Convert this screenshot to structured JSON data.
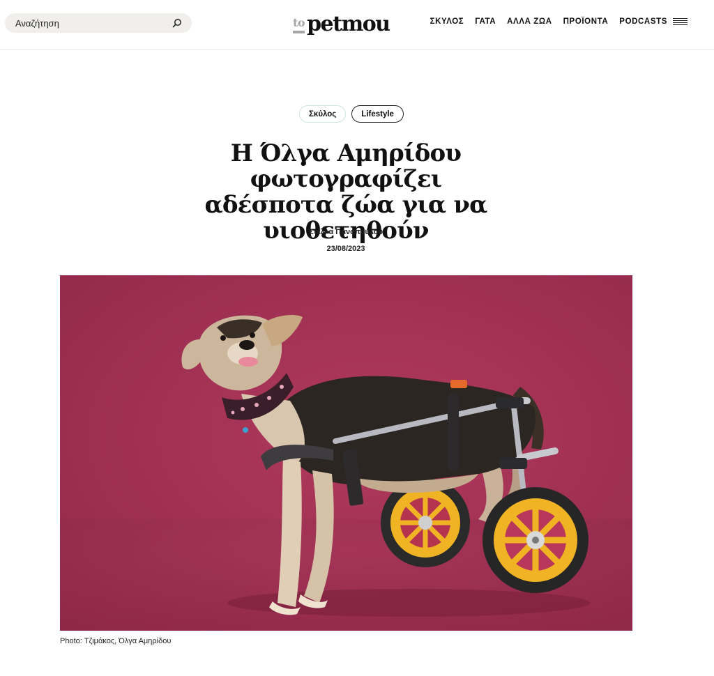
{
  "header": {
    "search": {
      "placeholder": "Αναζήτηση"
    },
    "logo": {
      "prefix": "to",
      "name": "petmou"
    },
    "nav": [
      "ΣΚΥΛΟΣ",
      "ΓΑΤΑ",
      "ΑΛΛΑ ΖΩΑ",
      "ΠΡΟΪΟΝΤΑ",
      "PODCASTS"
    ],
    "icons": {
      "search": "search-icon",
      "menu": "hamburger-menu-icon"
    }
  },
  "article": {
    "tags": [
      "Σκύλος",
      "Lifestyle"
    ],
    "title_lines": [
      "Η Όλγα Αμηρίδου φωτογραφίζει",
      "αδέσποτα ζώα για να",
      "υιοθετηθούν"
    ],
    "author": "Στέλλα Πανοπούλου",
    "date": "23/08/2023",
    "photo_caption": "Photo: Τζιμάκος, Όλγα Αμηρίδου"
  },
  "colors": {
    "backdrop": "#a13354",
    "search_bg": "#f1efec",
    "logo_prefix": "#a6a6a6",
    "wheel_rim": "#f0b323"
  }
}
